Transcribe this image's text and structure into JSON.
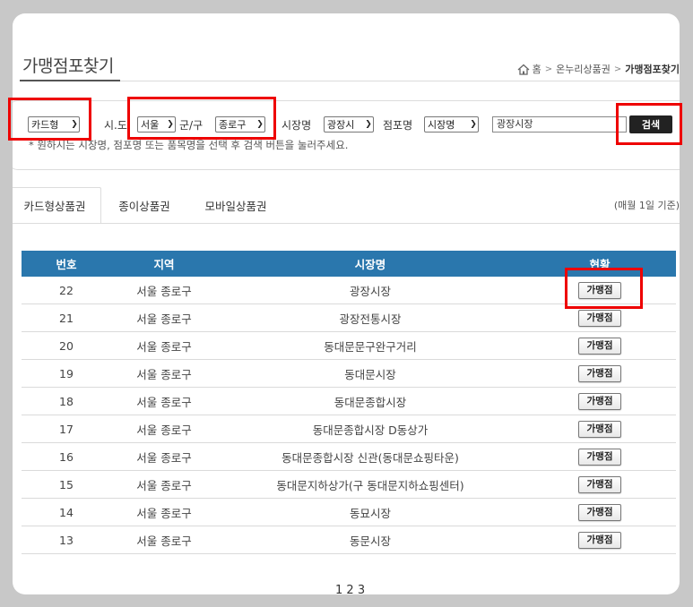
{
  "page": {
    "title": "가맹점포찾기",
    "breadcrumb": [
      "홈",
      "온누리상품권",
      "가맹점포찾기"
    ]
  },
  "search": {
    "card_type_selected": "카드형",
    "sido_label": "시.도",
    "sido_selected": "서울",
    "gungu_label": "군/구",
    "gungu_selected": "종로구",
    "market_label": "시장명",
    "market_selected": "광장시",
    "store_label": "점포명",
    "store_selected": "시장명",
    "keyword_value": "광장시장",
    "search_button": "검색",
    "hint": "* 원하시는 시장명, 점포명 또는 품목명을 선택 후 검색 버튼을 눌러주세요."
  },
  "tabs": [
    {
      "label": "카드형상품권",
      "active": true
    },
    {
      "label": "종이상품권",
      "active": false
    },
    {
      "label": "모바일상품권",
      "active": false
    }
  ],
  "tab_note": "(매월 1일 기준)",
  "table": {
    "headers": [
      "번호",
      "지역",
      "시장명",
      "현황"
    ],
    "rows": [
      {
        "no": "22",
        "region": "서울 종로구",
        "market": "광장시장",
        "status": "가맹점"
      },
      {
        "no": "21",
        "region": "서울 종로구",
        "market": "광장전통시장",
        "status": "가맹점"
      },
      {
        "no": "20",
        "region": "서울 종로구",
        "market": "동대문문구완구거리",
        "status": "가맹점"
      },
      {
        "no": "19",
        "region": "서울 종로구",
        "market": "동대문시장",
        "status": "가맹점"
      },
      {
        "no": "18",
        "region": "서울 종로구",
        "market": "동대문종합시장",
        "status": "가맹점"
      },
      {
        "no": "17",
        "region": "서울 종로구",
        "market": "동대문종합시장 D동상가",
        "status": "가맹점"
      },
      {
        "no": "16",
        "region": "서울 종로구",
        "market": "동대문종합시장 신관(동대문쇼핑타운)",
        "status": "가맹점"
      },
      {
        "no": "15",
        "region": "서울 종로구",
        "market": "동대문지하상가(구 동대문지하쇼핑센터)",
        "status": "가맹점"
      },
      {
        "no": "14",
        "region": "서울 종로구",
        "market": "동묘시장",
        "status": "가맹점"
      },
      {
        "no": "13",
        "region": "서울 종로구",
        "market": "동문시장",
        "status": "가맹점"
      }
    ]
  },
  "pagination": {
    "pages": [
      "1",
      "2",
      "3"
    ]
  },
  "colors": {
    "header_bg": "#2a77ad",
    "highlight": "#e00000",
    "button_dark": "#222222"
  }
}
